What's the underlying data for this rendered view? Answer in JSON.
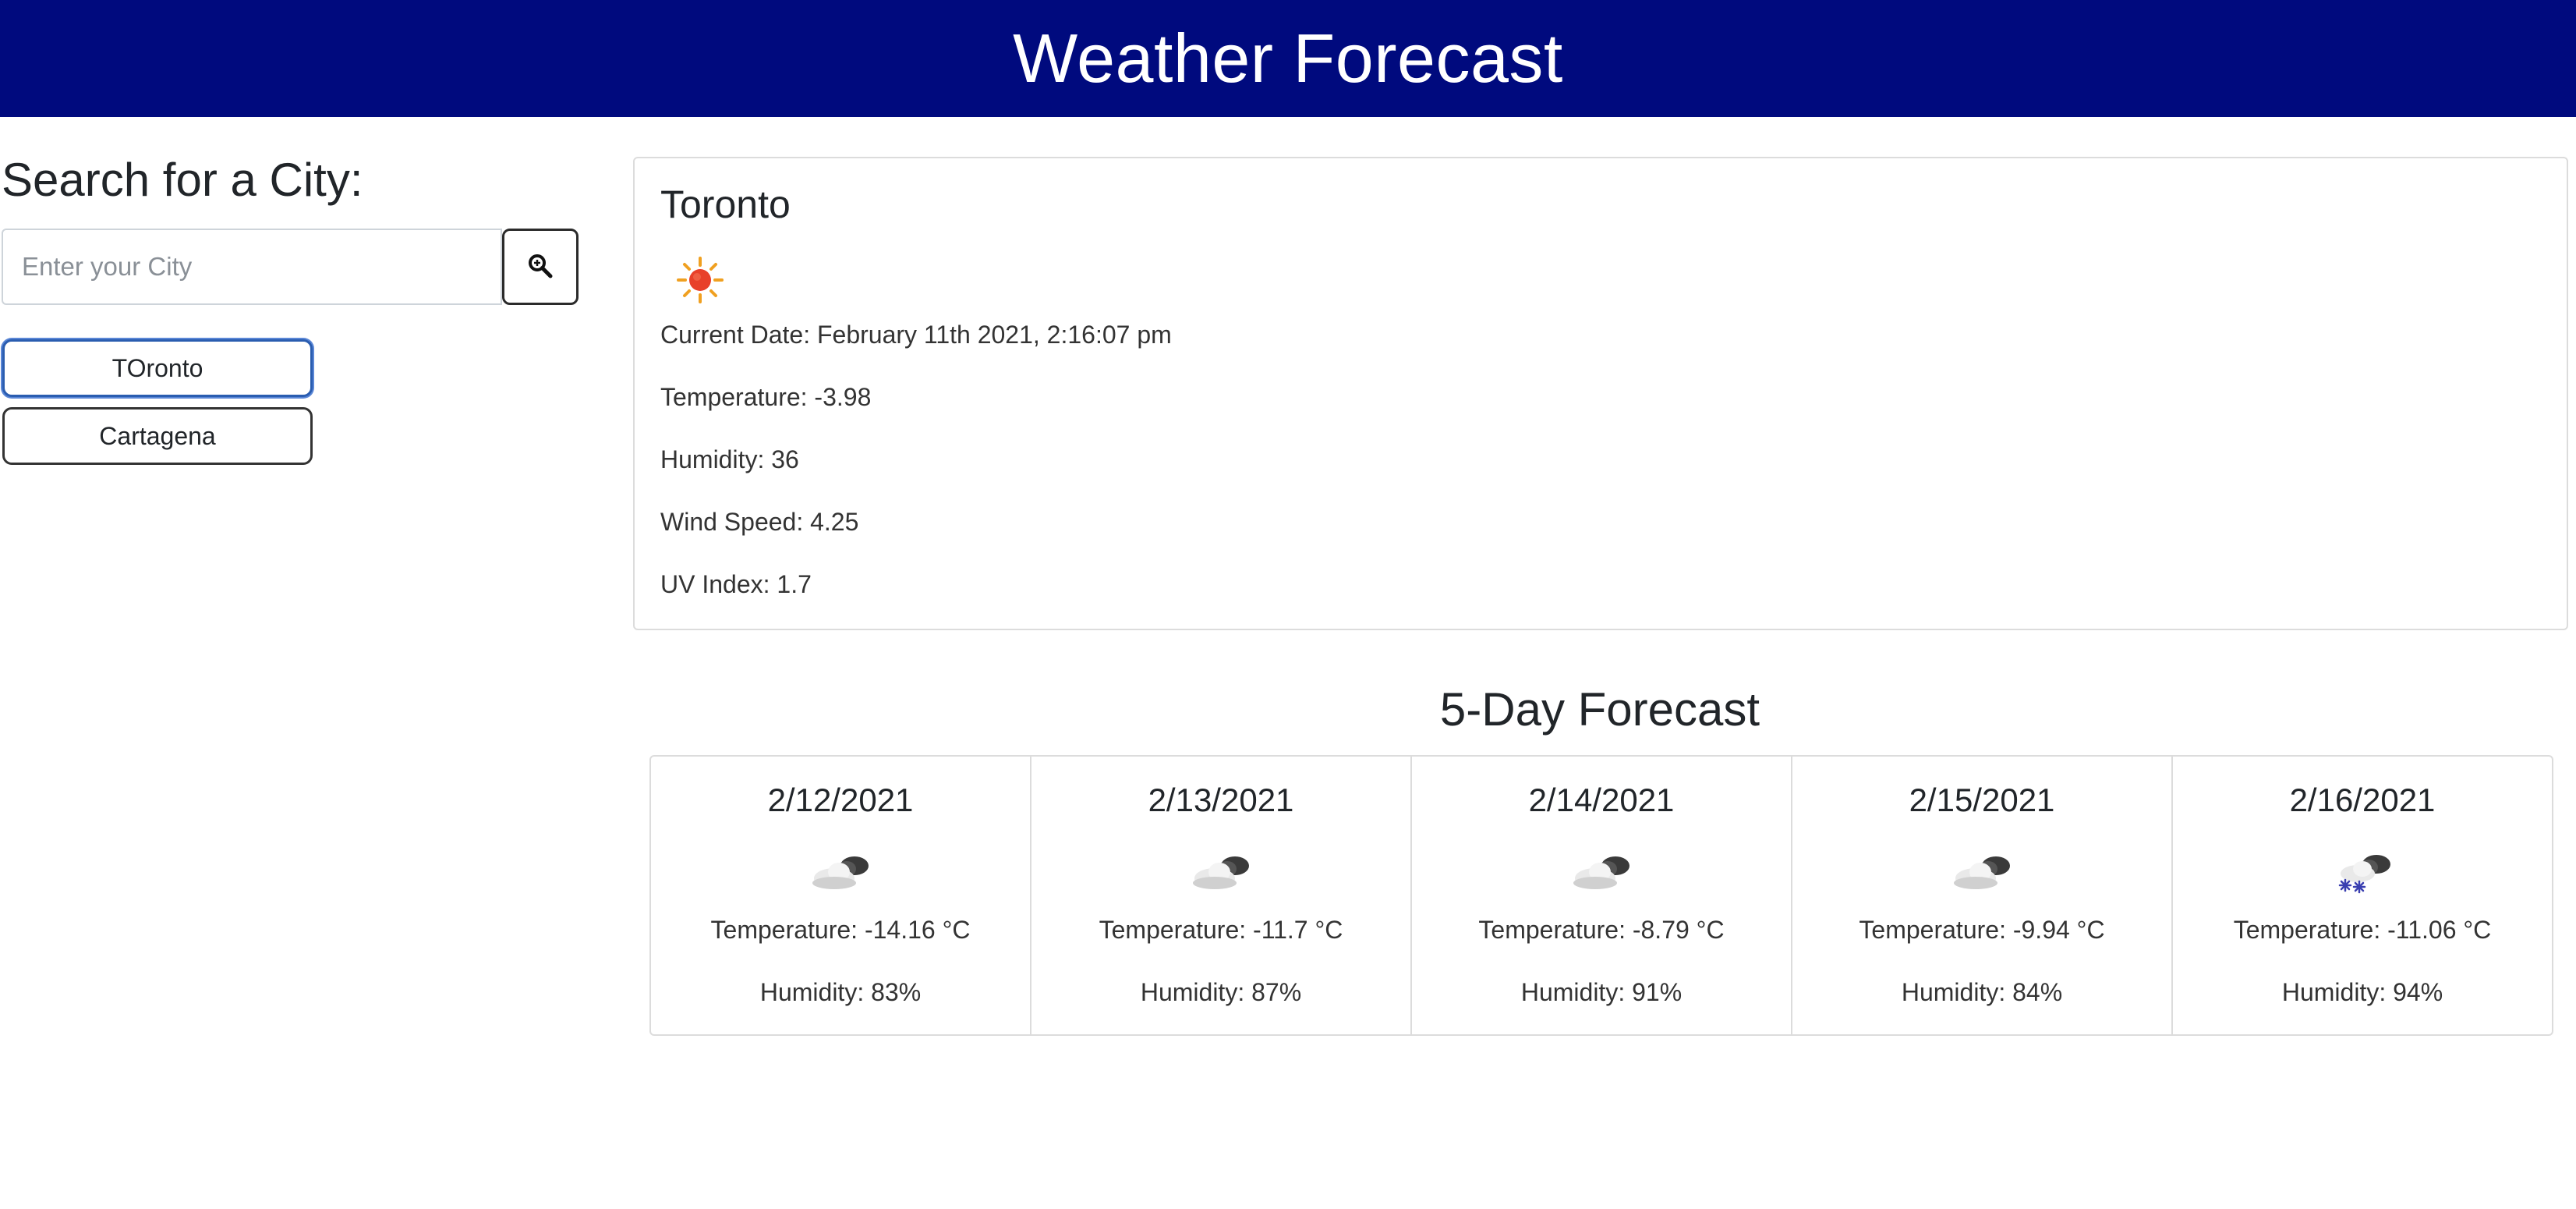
{
  "header": {
    "title": "Weather Forecast"
  },
  "search": {
    "title": "Search for a City:",
    "placeholder": "Enter your City",
    "button_icon": "search-zoom-icon"
  },
  "history": [
    {
      "label": "TOronto",
      "active": true
    },
    {
      "label": "Cartagena",
      "active": false
    }
  ],
  "current": {
    "city": "Toronto",
    "icon": "sun-icon",
    "date_text": "Current Date: February 11th 2021, 2:16:07 pm",
    "temperature_text": "Temperature: -3.98",
    "humidity_text": "Humidity: 36",
    "wind_text": "Wind Speed: 4.25",
    "uv_text": "UV Index: 1.7"
  },
  "forecast": {
    "title": "5-Day Forecast",
    "days": [
      {
        "date": "2/12/2021",
        "icon": "cloud-icon",
        "temperature": "Temperature: -14.16 °C",
        "humidity": "Humidity: 83%"
      },
      {
        "date": "2/13/2021",
        "icon": "cloud-icon",
        "temperature": "Temperature: -11.7 °C",
        "humidity": "Humidity: 87%"
      },
      {
        "date": "2/14/2021",
        "icon": "cloud-icon",
        "temperature": "Temperature: -8.79 °C",
        "humidity": "Humidity: 91%"
      },
      {
        "date": "2/15/2021",
        "icon": "cloud-icon",
        "temperature": "Temperature: -9.94 °C",
        "humidity": "Humidity: 84%"
      },
      {
        "date": "2/16/2021",
        "icon": "snow-cloud-icon",
        "temperature": "Temperature: -11.06 °C",
        "humidity": "Humidity: 94%"
      }
    ]
  },
  "colors": {
    "header_bg": "#000a7e",
    "header_text": "#ffffff",
    "active_border": "#2a5db0",
    "card_border": "#dcdcdc"
  }
}
